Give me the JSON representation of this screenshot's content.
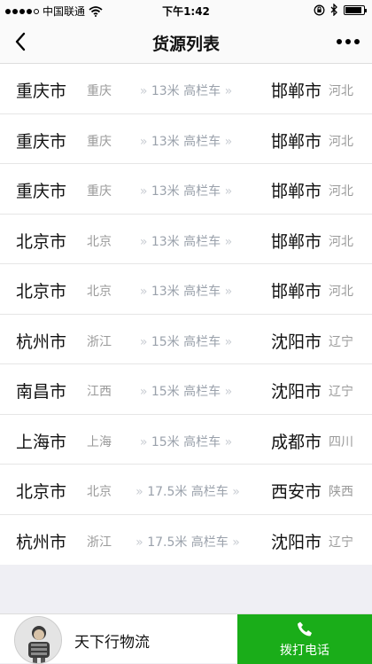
{
  "status_bar": {
    "carrier": "中国联通",
    "time": "下午1:42",
    "icons": [
      "signal-dots-icon",
      "wifi-icon",
      "lock-rotation-icon",
      "bluetooth-icon",
      "battery-icon"
    ],
    "battery_level": 0.9
  },
  "nav": {
    "title": "货源列表",
    "back_icon": "chevron-left-icon",
    "more_icon": "more-dots-icon"
  },
  "routes": [
    {
      "from_city": "重庆市",
      "from_province": "重庆",
      "spec": "13米 高栏车",
      "to_city": "邯郸市",
      "to_province": "河北"
    },
    {
      "from_city": "重庆市",
      "from_province": "重庆",
      "spec": "13米 高栏车",
      "to_city": "邯郸市",
      "to_province": "河北"
    },
    {
      "from_city": "重庆市",
      "from_province": "重庆",
      "spec": "13米 高栏车",
      "to_city": "邯郸市",
      "to_province": "河北"
    },
    {
      "from_city": "北京市",
      "from_province": "北京",
      "spec": "13米 高栏车",
      "to_city": "邯郸市",
      "to_province": "河北"
    },
    {
      "from_city": "北京市",
      "from_province": "北京",
      "spec": "13米 高栏车",
      "to_city": "邯郸市",
      "to_province": "河北"
    },
    {
      "from_city": "杭州市",
      "from_province": "浙江",
      "spec": "15米 高栏车",
      "to_city": "沈阳市",
      "to_province": "辽宁"
    },
    {
      "from_city": "南昌市",
      "from_province": "江西",
      "spec": "15米 高栏车",
      "to_city": "沈阳市",
      "to_province": "辽宁"
    },
    {
      "from_city": "上海市",
      "from_province": "上海",
      "spec": "15米 高栏车",
      "to_city": "成都市",
      "to_province": "四川"
    },
    {
      "from_city": "北京市",
      "from_province": "北京",
      "spec": "17.5米 高栏车",
      "to_city": "西安市",
      "to_province": "陕西"
    },
    {
      "from_city": "杭州市",
      "from_province": "浙江",
      "spec": "17.5米 高栏车",
      "to_city": "沈阳市",
      "to_province": "辽宁"
    }
  ],
  "footer": {
    "company_name": "天下行物流",
    "call_label": "拨打电话",
    "call_icon": "phone-icon",
    "colors": {
      "call_bg": "#1aad19"
    }
  }
}
